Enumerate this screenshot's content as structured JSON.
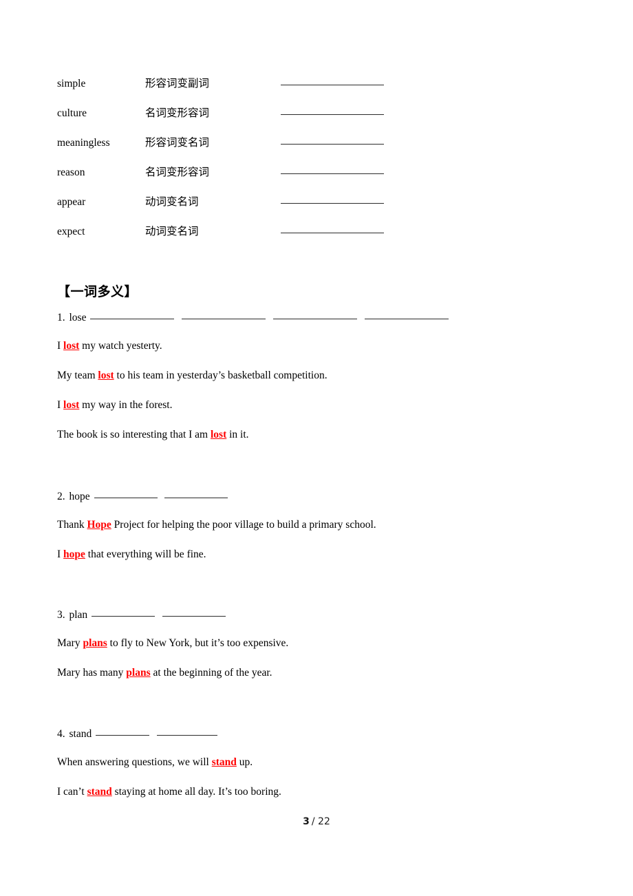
{
  "page": {
    "background_color": "#ffffff",
    "highlight_color": "#ff0000",
    "text_color": "#000000"
  },
  "wordform_table": {
    "rows": [
      {
        "word": "simple",
        "rule": "形容词变副词",
        "answer": ""
      },
      {
        "word": "culture",
        "rule": "名词变形容词",
        "answer": ""
      },
      {
        "word": "meaningless",
        "rule": "形容词变名词",
        "answer": ""
      },
      {
        "word": "reason",
        "rule": "名词变形容词",
        "answer": ""
      },
      {
        "word": "appear",
        "rule": "动词变名词",
        "answer": ""
      },
      {
        "word": "expect",
        "rule": "动词变名词",
        "answer": ""
      }
    ]
  },
  "polysemy_section": {
    "heading": "【一词多义】",
    "items": [
      {
        "number": "1.",
        "word": "lose",
        "blank_count": 4,
        "examples": [
          {
            "before": "I ",
            "highlight": "lost",
            "after": " my watch yesterty."
          },
          {
            "before": "My team ",
            "highlight": "lost",
            "after": " to his team in yesterday’s basketball competition."
          },
          {
            "before": "I ",
            "highlight": "lost",
            "after": " my way in the forest."
          },
          {
            "before": "The book is so interesting that I am ",
            "highlight": "lost",
            "after": " in it."
          }
        ]
      },
      {
        "number": "2.",
        "word": "hope",
        "blank_count": 2,
        "examples": [
          {
            "before": "Thank ",
            "highlight": "Hope",
            "after": " Project for helping the poor village to build a primary school."
          },
          {
            "before": "I ",
            "highlight": "hope",
            "after": " that everything will be fine."
          }
        ]
      },
      {
        "number": "3.",
        "word": "plan",
        "blank_count": 2,
        "examples": [
          {
            "before": "Mary ",
            "highlight": "plans",
            "after": " to fly to New York, but it’s too expensive."
          },
          {
            "before": "Mary has many ",
            "highlight": "plans",
            "after": " at the beginning of the year."
          }
        ]
      },
      {
        "number": "4.",
        "word": "stand",
        "blank_count": 2,
        "examples": [
          {
            "before": "When answering questions, we will ",
            "highlight": "stand",
            "after": " up."
          },
          {
            "before": "I can’t ",
            "highlight": "stand",
            "after": " staying at home all day. It’s too boring."
          }
        ]
      }
    ]
  },
  "footer": {
    "page_number": "3",
    "separator": "/ 22"
  }
}
